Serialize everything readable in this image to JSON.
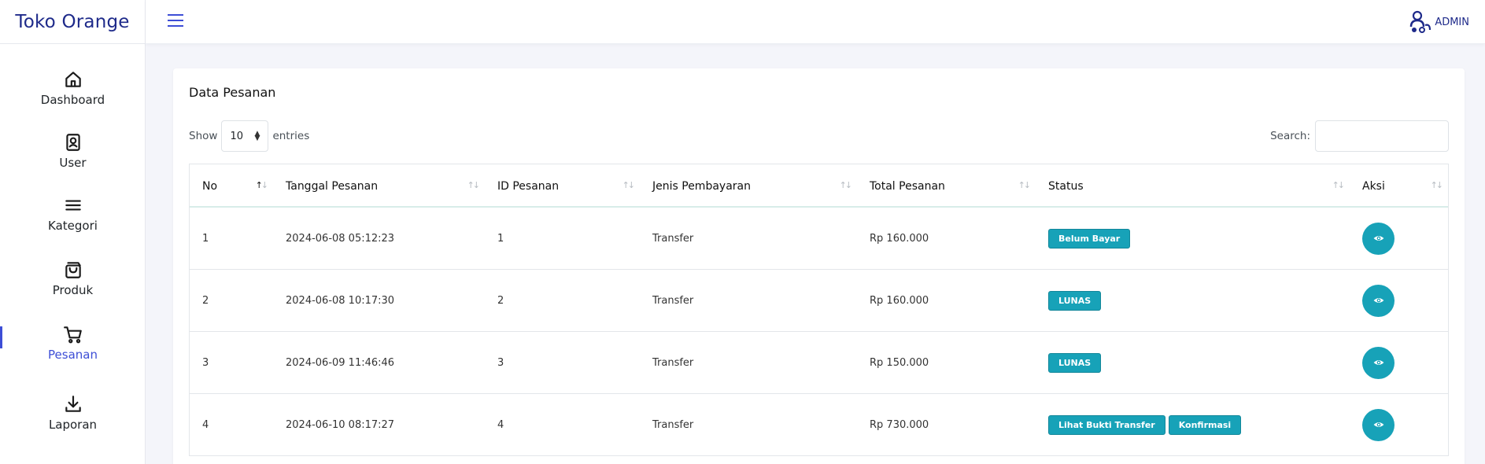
{
  "app": {
    "brand": "Toko Orange"
  },
  "topbar": {
    "user_label": "ADMIN"
  },
  "sidebar": {
    "items": [
      {
        "label": "Dashboard",
        "icon": "home-icon"
      },
      {
        "label": "User",
        "icon": "user-icon"
      },
      {
        "label": "Kategori",
        "icon": "list-icon"
      },
      {
        "label": "Produk",
        "icon": "bag-icon"
      },
      {
        "label": "Pesanan",
        "icon": "cart-icon",
        "active": true
      },
      {
        "label": "Laporan",
        "icon": "download-icon"
      }
    ]
  },
  "main": {
    "title": "Data Pesanan",
    "show_label": "Show",
    "entries_value": "10",
    "entries_label": "entries",
    "search_label": "Search:",
    "columns": [
      "No",
      "Tanggal Pesanan",
      "ID Pesanan",
      "Jenis Pembayaran",
      "Total Pesanan",
      "Status",
      "Aksi"
    ],
    "rows": [
      {
        "no": "1",
        "tanggal": "2024-06-08 05:12:23",
        "id": "1",
        "jenis": "Transfer",
        "total": "Rp 160.000",
        "status": [
          "Belum Bayar"
        ]
      },
      {
        "no": "2",
        "tanggal": "2024-06-08 10:17:30",
        "id": "2",
        "jenis": "Transfer",
        "total": "Rp 160.000",
        "status": [
          "LUNAS"
        ]
      },
      {
        "no": "3",
        "tanggal": "2024-06-09 11:46:46",
        "id": "3",
        "jenis": "Transfer",
        "total": "Rp 150.000",
        "status": [
          "LUNAS"
        ]
      },
      {
        "no": "4",
        "tanggal": "2024-06-10 08:17:27",
        "id": "4",
        "jenis": "Transfer",
        "total": "Rp 730.000",
        "status": [
          "Lihat Bukti Transfer",
          "Konfirmasi"
        ]
      }
    ]
  },
  "colors": {
    "accent": "#3d4ed6",
    "brand": "#1e2a8a",
    "badge": "#17a2b8"
  }
}
